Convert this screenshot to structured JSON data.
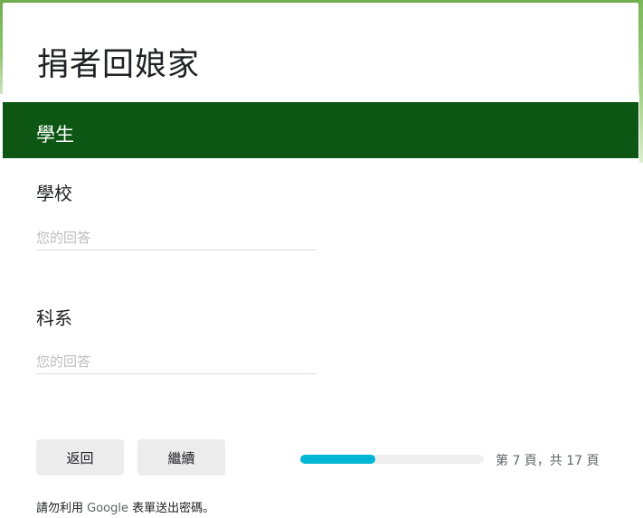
{
  "form": {
    "title": "捐者回娘家"
  },
  "section": {
    "title": "學生"
  },
  "questions": [
    {
      "label": "學校",
      "value": "",
      "placeholder": "您的回答"
    },
    {
      "label": "科系",
      "value": "",
      "placeholder": "您的回答"
    }
  ],
  "navigation": {
    "back_label": "返回",
    "next_label": "繼續"
  },
  "progress": {
    "current_page": 7,
    "total_pages": 17,
    "fraction": 0.41,
    "text": "第 7 頁，共 17 頁"
  },
  "footer": {
    "before": "請勿利用 ",
    "brand": "Google",
    "after": " 表單送出密碼。"
  },
  "colors": {
    "header_bg": "#0d5614",
    "progress_fill": "#00b6d4",
    "background_accent": "#8cc46a"
  }
}
